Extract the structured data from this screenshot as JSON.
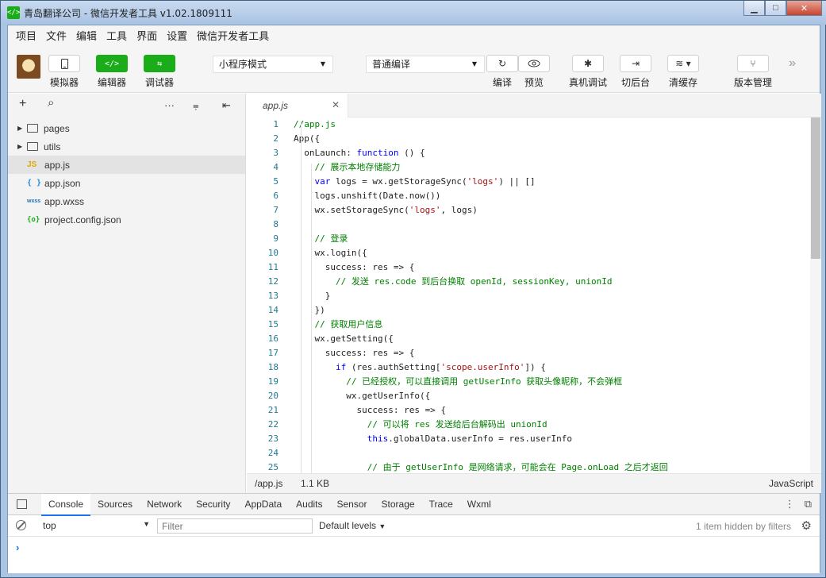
{
  "window": {
    "title": "青岛翻译公司 - 微信开发者工具 v1.02.1809111",
    "title_icon": "</>",
    "min_label": "▁",
    "max_label": "□",
    "close_label": "✕"
  },
  "menu": [
    "项目",
    "文件",
    "编辑",
    "工具",
    "界面",
    "设置",
    "微信开发者工具"
  ],
  "toolbar": {
    "simulator": "模拟器",
    "editor": "编辑器",
    "debugger": "调试器",
    "mode_select": "小程序模式",
    "compile_select": "普通编译",
    "compile": "编译",
    "preview": "预览",
    "remote_debug": "真机调试",
    "background": "切后台",
    "clear_cache": "清缓存",
    "version": "版本管理",
    "more": "»"
  },
  "explorer": {
    "add": "+",
    "search": "⌕",
    "more": "···",
    "tree": [
      {
        "name": "pages",
        "type": "folder"
      },
      {
        "name": "utils",
        "type": "folder"
      },
      {
        "name": "app.js",
        "type": "js",
        "icon": "JS"
      },
      {
        "name": "app.json",
        "type": "json",
        "icon": "{ }"
      },
      {
        "name": "app.wxss",
        "type": "wxss",
        "icon": "wxss"
      },
      {
        "name": "project.config.json",
        "type": "config",
        "icon": "{o}"
      }
    ]
  },
  "editor": {
    "tab_label": "app.js",
    "tab_close": "✕",
    "status_path": "/app.js",
    "status_size": "1.1 KB",
    "status_lang": "JavaScript"
  },
  "code_lines": [
    [
      {
        "t": "//app.js",
        "c": "cm"
      }
    ],
    [
      {
        "t": "App({",
        "c": ""
      }
    ],
    [
      {
        "t": "  onLaunch: ",
        "c": ""
      },
      {
        "t": "function",
        "c": "kw"
      },
      {
        "t": " () {",
        "c": ""
      }
    ],
    [
      {
        "t": "    // 展示本地存储能力",
        "c": "cm"
      }
    ],
    [
      {
        "t": "    ",
        "c": ""
      },
      {
        "t": "var",
        "c": "kw"
      },
      {
        "t": " logs = wx.getStorageSync(",
        "c": ""
      },
      {
        "t": "'logs'",
        "c": "str"
      },
      {
        "t": ") || []",
        "c": ""
      }
    ],
    [
      {
        "t": "    logs.unshift(Date.now())",
        "c": ""
      }
    ],
    [
      {
        "t": "    wx.setStorageSync(",
        "c": ""
      },
      {
        "t": "'logs'",
        "c": "str"
      },
      {
        "t": ", logs)",
        "c": ""
      }
    ],
    [
      {
        "t": "",
        "c": ""
      }
    ],
    [
      {
        "t": "    // 登录",
        "c": "cm"
      }
    ],
    [
      {
        "t": "    wx.login({",
        "c": ""
      }
    ],
    [
      {
        "t": "      success: res => {",
        "c": ""
      }
    ],
    [
      {
        "t": "        // 发送 res.code 到后台换取 openId, sessionKey, unionId",
        "c": "cm"
      }
    ],
    [
      {
        "t": "      }",
        "c": ""
      }
    ],
    [
      {
        "t": "    })",
        "c": ""
      }
    ],
    [
      {
        "t": "    // 获取用户信息",
        "c": "cm"
      }
    ],
    [
      {
        "t": "    wx.getSetting({",
        "c": ""
      }
    ],
    [
      {
        "t": "      success: res => {",
        "c": ""
      }
    ],
    [
      {
        "t": "        ",
        "c": ""
      },
      {
        "t": "if",
        "c": "kw"
      },
      {
        "t": " (res.authSetting[",
        "c": ""
      },
      {
        "t": "'scope.userInfo'",
        "c": "str"
      },
      {
        "t": "]) {",
        "c": ""
      }
    ],
    [
      {
        "t": "          // 已经授权，可以直接调用 getUserInfo 获取头像昵称，不会弹框",
        "c": "cm"
      }
    ],
    [
      {
        "t": "          wx.getUserInfo({",
        "c": ""
      }
    ],
    [
      {
        "t": "            success: res => {",
        "c": ""
      }
    ],
    [
      {
        "t": "              // 可以将 res 发送给后台解码出 unionId",
        "c": "cm"
      }
    ],
    [
      {
        "t": "              ",
        "c": ""
      },
      {
        "t": "this",
        "c": "kw"
      },
      {
        "t": ".globalData.userInfo = res.userInfo",
        "c": ""
      }
    ],
    [
      {
        "t": "",
        "c": ""
      }
    ],
    [
      {
        "t": "              // 由于 getUserInfo 是网络请求，可能会在 Page.onLoad 之后才返回",
        "c": "cm"
      }
    ]
  ],
  "devtools": {
    "tabs": [
      "Console",
      "Sources",
      "Network",
      "Security",
      "AppData",
      "Audits",
      "Sensor",
      "Storage",
      "Trace",
      "Wxml"
    ],
    "active_tab": "Console",
    "context": "top",
    "filter_placeholder": "Filter",
    "levels": "Default levels",
    "hidden_note": "1 item hidden by filters",
    "prompt": "›"
  }
}
